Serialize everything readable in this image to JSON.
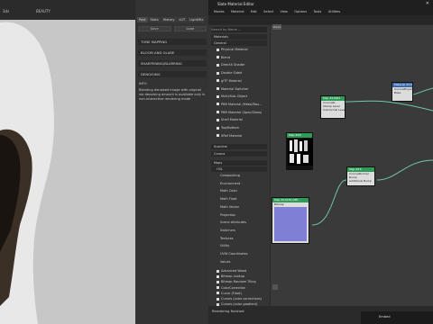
{
  "viewport": {
    "top_text": "BEAUTY",
    "icon_label": "3ds"
  },
  "settings": {
    "tabs": [
      "Post",
      "Stats",
      "History",
      "LUT",
      "LightMix"
    ],
    "buttons": [
      "Save",
      "Load"
    ],
    "sections": [
      "TONE MAPPING",
      "BLOOM AND GLARE",
      "SHARPENING/BLURRING",
      "DENOISING"
    ],
    "note_title": "INFO",
    "note_text": "Blending denoised image with original via denoising amount is available only in non-interactive rendering mode"
  },
  "slate": {
    "title": "Slate Material Editor",
    "menu": [
      "Modes",
      "Material",
      "Edit",
      "Select",
      "View",
      "Options",
      "Tools",
      "Utilities"
    ],
    "view_tab": "View1",
    "search_placeholder": "Search by Name ...",
    "browser": {
      "materials_header": "Materials",
      "general_header": "General",
      "general_items": [
        "Physical Material",
        "Blend",
        "DirectX Shader",
        "Double Sided",
        "glTF Material",
        "Material Switcher",
        "Multi/Sub-Object",
        "PBR Material (Metal/Rou...",
        "PBR Material (Spec/Gloss)",
        "Shell Material",
        "Top/Bottom",
        "XRef Material"
      ],
      "headers2": [
        "Scanline",
        "Corona"
      ],
      "maps_header": "Maps",
      "osl_header": "OSL",
      "osl_items": [
        "Compositing",
        "Environment",
        "Math Color",
        "Math Float",
        "Math Vector",
        "Projection",
        "Scene Attributes",
        "Switchers",
        "Textures",
        "Utility",
        "UVW Coordinates",
        "Values"
      ],
      "map_items": [
        "Advanced Wood",
        "Bitmap Lookup",
        "Bitmap Random Tiling",
        "ColorCorrection",
        "Curve (Float)",
        "Curves (color corrections)",
        "Curves (color gradient)"
      ]
    },
    "nodes": [
      {
        "title": "Map #10001",
        "subtitle": "CoronaN..",
        "rows": [
          "Stamp Level",
          "Subnormal Level",
          "Ret Material"
        ]
      },
      {
        "title": "Map #44",
        "subtitle": "Bitmap",
        "rows": []
      },
      {
        "title": "Map #15",
        "subtitle": "CoronaNormal",
        "rows": [
          "Bump",
          "Additional Bump"
        ]
      },
      {
        "title": "Map #10139 (MH..",
        "subtitle": "Bitmap",
        "rows": []
      },
      {
        "title": "Material #135",
        "subtitle": "CoronaPhysical",
        "rows": [
          "Base",
          "Opacity"
        ]
      }
    ],
    "status_text": "Rendering finished",
    "taskbar_text": "Embed",
    "colors": {
      "node_header_green": "#2e9c58",
      "node_header_blue": "#3a6aa8",
      "wire_color": "#6fc7a8"
    }
  }
}
